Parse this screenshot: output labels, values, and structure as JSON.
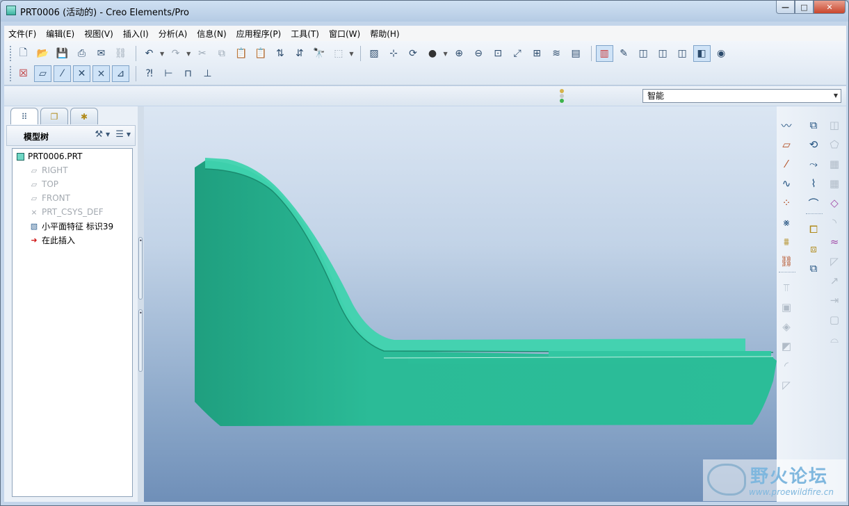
{
  "window": {
    "title": "PRT0006 (活动的) - Creo Elements/Pro",
    "controls": {
      "minimize": "—",
      "maximize": "□",
      "close": "✕"
    }
  },
  "menu": [
    "文件(F)",
    "编辑(E)",
    "视图(V)",
    "插入(I)",
    "分析(A)",
    "信息(N)",
    "应用程序(P)",
    "工具(T)",
    "窗口(W)",
    "帮助(H)"
  ],
  "toolbar": {
    "row1_file": [
      "new-icon",
      "open-icon",
      "save-icon",
      "print-icon",
      "send-mail-icon",
      "send-link-icon"
    ],
    "row1_edit": [
      "undo-icon",
      "redo-icon",
      "cut-icon",
      "copy-icon",
      "paste-icon",
      "paste-special-icon",
      "regenerate-icon",
      "regen-manager-icon",
      "find-icon",
      "select-box-icon"
    ],
    "row1_view": [
      "repaint-icon",
      "spin-center-icon",
      "orient-mode-icon",
      "appearance-icon",
      "zoom-in-icon",
      "zoom-out-icon",
      "refit-icon",
      "reorient-icon",
      "saved-views-icon",
      "layers-icon",
      "view-manager-icon"
    ],
    "row1_display": [
      "color-display-icon",
      "sketch-display-icon",
      "wireframe-icon",
      "hidden-line-icon",
      "no-hidden-icon",
      "shading-icon",
      "model-tree-icon"
    ],
    "row2_datum": [
      "close-window-icon",
      "datum-planes-icon",
      "datum-axes-icon",
      "datum-points-icon",
      "csys-icon",
      "annotations-icon"
    ],
    "row2_tools": [
      "whats-this-icon",
      "measure-icon",
      "measure-area-icon",
      "measure-length-icon"
    ]
  },
  "status": {
    "filter_value": "智能"
  },
  "model_tree": {
    "tabs": [
      "model-tree-tab-icon",
      "folder-browser-tab-icon",
      "favorites-tab-icon"
    ],
    "title": "模型树",
    "items": [
      {
        "label": "PRT0006.PRT",
        "icon": "part-icon",
        "indent": 0,
        "dim": false
      },
      {
        "label": "RIGHT",
        "icon": "datum-plane-icon",
        "indent": 1,
        "dim": true
      },
      {
        "label": "TOP",
        "icon": "datum-plane-icon",
        "indent": 1,
        "dim": true
      },
      {
        "label": "FRONT",
        "icon": "datum-plane-icon",
        "indent": 1,
        "dim": true
      },
      {
        "label": "PRT_CSYS_DEF",
        "icon": "csys-icon",
        "indent": 1,
        "dim": true
      },
      {
        "label": "小平面特征 标识39",
        "icon": "facet-feature-icon",
        "indent": 1,
        "dim": false
      },
      {
        "label": "在此插入",
        "icon": "insert-here-arrow-icon",
        "indent": 1,
        "dim": false
      }
    ]
  },
  "right_toolbar": {
    "col1": [
      "sketch-tool-icon",
      "datum-plane-tool-icon",
      "datum-axis-tool-icon",
      "datum-curve-tool-icon",
      "datum-point-tool-icon",
      "sketched-point-icon",
      "offset-csys-point-icon",
      "csys-tool-icon",
      "analysis-feature-icon",
      "hole-tool-icon",
      "shell-tool-icon",
      "rib-tool-icon",
      "draft-tool-icon",
      "round-tool-icon",
      "chamfer-tool-icon"
    ],
    "col2": [
      "extrude-icon",
      "revolve-icon",
      "sweep-icon",
      "boundary-blend-icon",
      "variable-section-sweep-icon",
      "copy-icon",
      "mirror-icon",
      "merge-icon"
    ],
    "col3": [
      "pattern-icon",
      "trim-icon",
      "intersect-icon",
      "extend-icon",
      "offset-icon",
      "thicken-icon",
      "solidify-icon",
      "project-icon",
      "wrap-icon",
      "fill-icon",
      "surface-merge-icon",
      "transform-icon"
    ]
  },
  "colors": {
    "model_fill": "#2bbd98",
    "model_shadow": "#1e9b7a",
    "model_highlight": "#3fd7b1",
    "viewport_top": "#dbe6f3",
    "viewport_bottom": "#6f8fb8"
  },
  "watermark": {
    "title": "野火论坛",
    "url": "www.proewildfire.cn"
  }
}
